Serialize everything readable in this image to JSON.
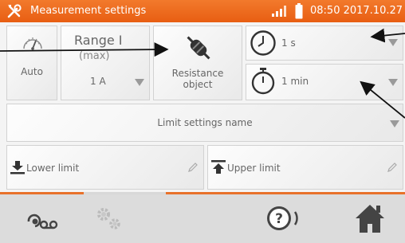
{
  "titlebar": {
    "title": "Measurement settings",
    "clock": "08:50 2017.10.27",
    "tool_icon": "wrench-screwdriver-icon",
    "signal_icon": "signal-bars-icon",
    "battery_icon": "battery-icon"
  },
  "settings": {
    "auto_label": "Auto",
    "range_label": "Range I",
    "range_sub": "(max)",
    "range_value": "1 A",
    "object_label": "Resistance\nobject",
    "time1_value": "1 s",
    "time2_value": "1 min",
    "limit_name_label": "Limit settings name",
    "lower_limit_label": "Lower limit",
    "upper_limit_label": "Upper limit"
  },
  "bottombar": {
    "record_icon": "recording-icon",
    "settings_icon": "settings-gears-icon",
    "help_icon": "help-icon",
    "home_icon": "home-icon"
  },
  "colors": {
    "accent": "#e8712a",
    "tile_text": "#666666",
    "bottom_bar": "#dcdcdc"
  }
}
